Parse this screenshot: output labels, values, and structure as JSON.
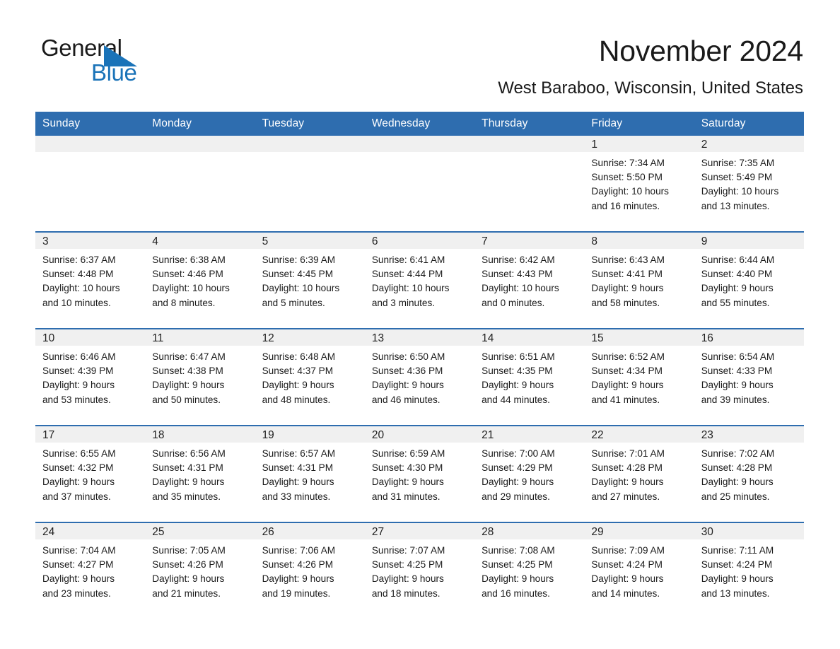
{
  "brand": {
    "word1": "General",
    "word2": "Blue",
    "triangle_color": "#1A73B8"
  },
  "header": {
    "title": "November 2024",
    "location": "West Baraboo, Wisconsin, United States"
  },
  "theme": {
    "header_blue": "#2E6DAF",
    "daynum_gray": "#F0F0F0",
    "cell_white": "#FFFFFF",
    "text": "#1a1a1a"
  },
  "weekday_headers": [
    "Sunday",
    "Monday",
    "Tuesday",
    "Wednesday",
    "Thursday",
    "Friday",
    "Saturday"
  ],
  "labels": {
    "sunrise_prefix": "Sunrise:",
    "sunset_prefix": "Sunset:",
    "daylight_prefix": "Daylight:"
  },
  "weeks": [
    [
      {
        "empty": true
      },
      {
        "empty": true
      },
      {
        "empty": true
      },
      {
        "empty": true
      },
      {
        "empty": true
      },
      {
        "day": "1",
        "sunrise": "Sunrise: 7:34 AM",
        "sunset": "Sunset: 5:50 PM",
        "daylight_l1": "Daylight: 10 hours",
        "daylight_l2": "and 16 minutes."
      },
      {
        "day": "2",
        "sunrise": "Sunrise: 7:35 AM",
        "sunset": "Sunset: 5:49 PM",
        "daylight_l1": "Daylight: 10 hours",
        "daylight_l2": "and 13 minutes."
      }
    ],
    [
      {
        "day": "3",
        "sunrise": "Sunrise: 6:37 AM",
        "sunset": "Sunset: 4:48 PM",
        "daylight_l1": "Daylight: 10 hours",
        "daylight_l2": "and 10 minutes."
      },
      {
        "day": "4",
        "sunrise": "Sunrise: 6:38 AM",
        "sunset": "Sunset: 4:46 PM",
        "daylight_l1": "Daylight: 10 hours",
        "daylight_l2": "and 8 minutes."
      },
      {
        "day": "5",
        "sunrise": "Sunrise: 6:39 AM",
        "sunset": "Sunset: 4:45 PM",
        "daylight_l1": "Daylight: 10 hours",
        "daylight_l2": "and 5 minutes."
      },
      {
        "day": "6",
        "sunrise": "Sunrise: 6:41 AM",
        "sunset": "Sunset: 4:44 PM",
        "daylight_l1": "Daylight: 10 hours",
        "daylight_l2": "and 3 minutes."
      },
      {
        "day": "7",
        "sunrise": "Sunrise: 6:42 AM",
        "sunset": "Sunset: 4:43 PM",
        "daylight_l1": "Daylight: 10 hours",
        "daylight_l2": "and 0 minutes."
      },
      {
        "day": "8",
        "sunrise": "Sunrise: 6:43 AM",
        "sunset": "Sunset: 4:41 PM",
        "daylight_l1": "Daylight: 9 hours",
        "daylight_l2": "and 58 minutes."
      },
      {
        "day": "9",
        "sunrise": "Sunrise: 6:44 AM",
        "sunset": "Sunset: 4:40 PM",
        "daylight_l1": "Daylight: 9 hours",
        "daylight_l2": "and 55 minutes."
      }
    ],
    [
      {
        "day": "10",
        "sunrise": "Sunrise: 6:46 AM",
        "sunset": "Sunset: 4:39 PM",
        "daylight_l1": "Daylight: 9 hours",
        "daylight_l2": "and 53 minutes."
      },
      {
        "day": "11",
        "sunrise": "Sunrise: 6:47 AM",
        "sunset": "Sunset: 4:38 PM",
        "daylight_l1": "Daylight: 9 hours",
        "daylight_l2": "and 50 minutes."
      },
      {
        "day": "12",
        "sunrise": "Sunrise: 6:48 AM",
        "sunset": "Sunset: 4:37 PM",
        "daylight_l1": "Daylight: 9 hours",
        "daylight_l2": "and 48 minutes."
      },
      {
        "day": "13",
        "sunrise": "Sunrise: 6:50 AM",
        "sunset": "Sunset: 4:36 PM",
        "daylight_l1": "Daylight: 9 hours",
        "daylight_l2": "and 46 minutes."
      },
      {
        "day": "14",
        "sunrise": "Sunrise: 6:51 AM",
        "sunset": "Sunset: 4:35 PM",
        "daylight_l1": "Daylight: 9 hours",
        "daylight_l2": "and 44 minutes."
      },
      {
        "day": "15",
        "sunrise": "Sunrise: 6:52 AM",
        "sunset": "Sunset: 4:34 PM",
        "daylight_l1": "Daylight: 9 hours",
        "daylight_l2": "and 41 minutes."
      },
      {
        "day": "16",
        "sunrise": "Sunrise: 6:54 AM",
        "sunset": "Sunset: 4:33 PM",
        "daylight_l1": "Daylight: 9 hours",
        "daylight_l2": "and 39 minutes."
      }
    ],
    [
      {
        "day": "17",
        "sunrise": "Sunrise: 6:55 AM",
        "sunset": "Sunset: 4:32 PM",
        "daylight_l1": "Daylight: 9 hours",
        "daylight_l2": "and 37 minutes."
      },
      {
        "day": "18",
        "sunrise": "Sunrise: 6:56 AM",
        "sunset": "Sunset: 4:31 PM",
        "daylight_l1": "Daylight: 9 hours",
        "daylight_l2": "and 35 minutes."
      },
      {
        "day": "19",
        "sunrise": "Sunrise: 6:57 AM",
        "sunset": "Sunset: 4:31 PM",
        "daylight_l1": "Daylight: 9 hours",
        "daylight_l2": "and 33 minutes."
      },
      {
        "day": "20",
        "sunrise": "Sunrise: 6:59 AM",
        "sunset": "Sunset: 4:30 PM",
        "daylight_l1": "Daylight: 9 hours",
        "daylight_l2": "and 31 minutes."
      },
      {
        "day": "21",
        "sunrise": "Sunrise: 7:00 AM",
        "sunset": "Sunset: 4:29 PM",
        "daylight_l1": "Daylight: 9 hours",
        "daylight_l2": "and 29 minutes."
      },
      {
        "day": "22",
        "sunrise": "Sunrise: 7:01 AM",
        "sunset": "Sunset: 4:28 PM",
        "daylight_l1": "Daylight: 9 hours",
        "daylight_l2": "and 27 minutes."
      },
      {
        "day": "23",
        "sunrise": "Sunrise: 7:02 AM",
        "sunset": "Sunset: 4:28 PM",
        "daylight_l1": "Daylight: 9 hours",
        "daylight_l2": "and 25 minutes."
      }
    ],
    [
      {
        "day": "24",
        "sunrise": "Sunrise: 7:04 AM",
        "sunset": "Sunset: 4:27 PM",
        "daylight_l1": "Daylight: 9 hours",
        "daylight_l2": "and 23 minutes."
      },
      {
        "day": "25",
        "sunrise": "Sunrise: 7:05 AM",
        "sunset": "Sunset: 4:26 PM",
        "daylight_l1": "Daylight: 9 hours",
        "daylight_l2": "and 21 minutes."
      },
      {
        "day": "26",
        "sunrise": "Sunrise: 7:06 AM",
        "sunset": "Sunset: 4:26 PM",
        "daylight_l1": "Daylight: 9 hours",
        "daylight_l2": "and 19 minutes."
      },
      {
        "day": "27",
        "sunrise": "Sunrise: 7:07 AM",
        "sunset": "Sunset: 4:25 PM",
        "daylight_l1": "Daylight: 9 hours",
        "daylight_l2": "and 18 minutes."
      },
      {
        "day": "28",
        "sunrise": "Sunrise: 7:08 AM",
        "sunset": "Sunset: 4:25 PM",
        "daylight_l1": "Daylight: 9 hours",
        "daylight_l2": "and 16 minutes."
      },
      {
        "day": "29",
        "sunrise": "Sunrise: 7:09 AM",
        "sunset": "Sunset: 4:24 PM",
        "daylight_l1": "Daylight: 9 hours",
        "daylight_l2": "and 14 minutes."
      },
      {
        "day": "30",
        "sunrise": "Sunrise: 7:11 AM",
        "sunset": "Sunset: 4:24 PM",
        "daylight_l1": "Daylight: 9 hours",
        "daylight_l2": "and 13 minutes."
      }
    ]
  ]
}
